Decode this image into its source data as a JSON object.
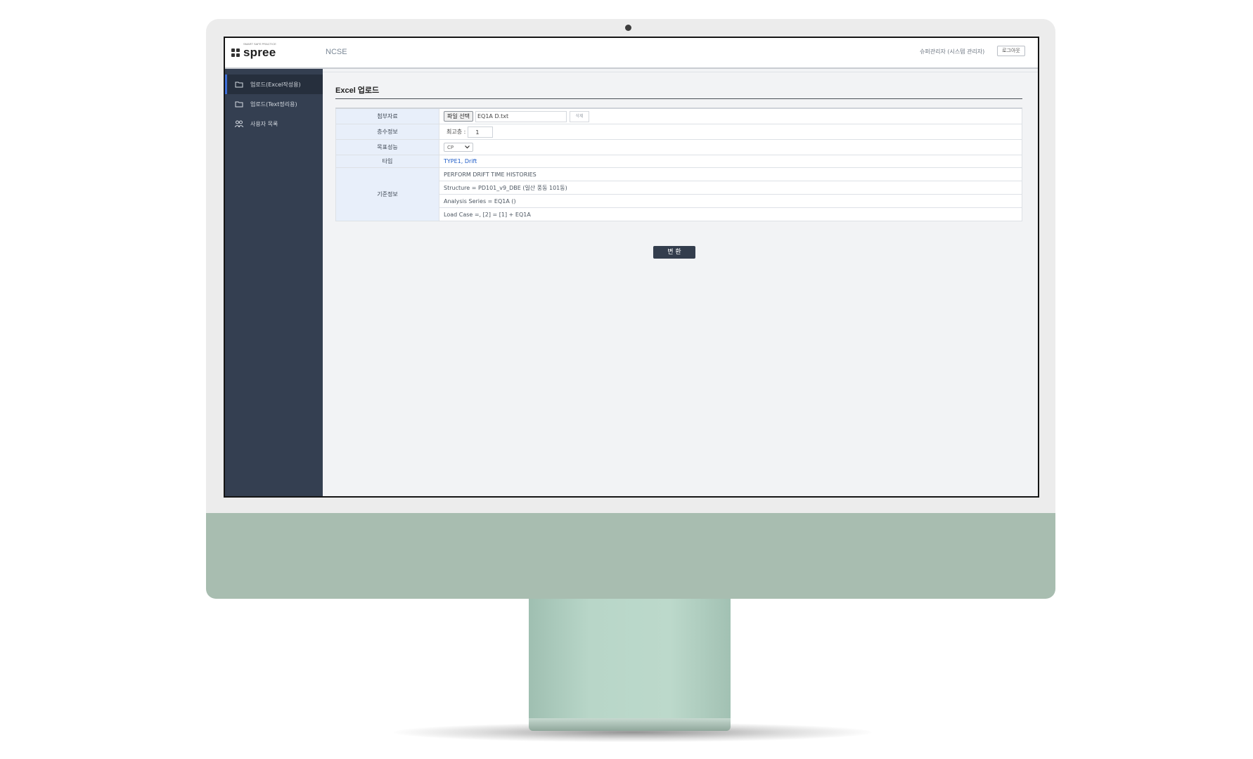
{
  "header": {
    "logo_text": "spree",
    "logo_tagline": "SMART SAFE PRACTICE",
    "app_name": "NCSE",
    "user_label": "슈퍼관리자 (시스템 관리자)",
    "logout_label": "로그아웃"
  },
  "sidebar": {
    "items": [
      {
        "label": "업로드(Excel작성용)",
        "icon": "folder-icon",
        "active": true
      },
      {
        "label": "업로드(Text정리용)",
        "icon": "folder-icon",
        "active": false
      },
      {
        "label": "사용자 목록",
        "icon": "users-icon",
        "active": false
      }
    ]
  },
  "main": {
    "title": "Excel 업로드",
    "rows": {
      "attachment": {
        "label": "첨부자료",
        "file_button": "파일 선택",
        "file_name": "EQ1A D.txt",
        "delete_button": "삭제"
      },
      "floor_info": {
        "label": "층수정보",
        "floor_label": "최고층 :",
        "floor_value": "1"
      },
      "target_performance": {
        "label": "목표성능",
        "selected": "CP"
      },
      "type": {
        "label": "타입",
        "value": "TYPE1, Drift"
      },
      "base_info": {
        "label": "기준정보",
        "lines": [
          "PERFORM DRIFT TIME HISTORIES",
          "Structure = PD101_v9_DBE (일산 풍동 101동)",
          "Analysis Series = EQ1A ()",
          "Load Case =, [2] = [1] + EQ1A"
        ]
      }
    },
    "convert_button": "변 환"
  },
  "colors": {
    "sidebar_bg": "#343f51",
    "active_accent": "#3e6fd8",
    "button_dark": "#333d4d",
    "label_bg": "#e8effa",
    "type_text": "#1e5cc8",
    "monitor_chin": "#a8bdb0"
  }
}
